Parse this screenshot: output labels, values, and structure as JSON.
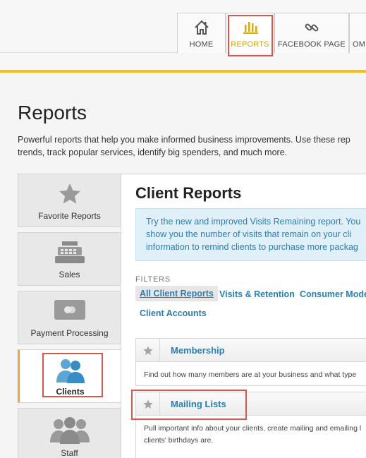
{
  "nav": {
    "tabs": [
      {
        "label": "HOME",
        "icon": "home-icon"
      },
      {
        "label": "REPORTS",
        "icon": "bar-chart-icon",
        "active": true
      },
      {
        "label": "FACEBOOK PAGE",
        "icon": "link-icon"
      },
      {
        "label": "OM",
        "icon": ""
      }
    ]
  },
  "page": {
    "title": "Reports",
    "description_line1": "Powerful reports that help you make informed business improvements. Use these rep",
    "description_line2": "trends, track popular services, identify big spenders, and much more."
  },
  "sidebar": {
    "items": [
      {
        "label": "Favorite Reports",
        "icon": "star-icon"
      },
      {
        "label": "Sales",
        "icon": "cash-register-icon"
      },
      {
        "label": "Payment Processing",
        "icon": "credit-card-icon"
      },
      {
        "label": "Clients",
        "icon": "clients-icon",
        "active": true
      },
      {
        "label": "Staff",
        "icon": "staff-icon"
      }
    ]
  },
  "main": {
    "title": "Client Reports",
    "notice_line1": "Try the new and improved Visits Remaining report. You",
    "notice_line2": "show you the number of visits that remain on your cli",
    "notice_line3": "information to remind clients to purchase more packag",
    "filters_label": "FILTERS",
    "filters": [
      "All Client Reports",
      "Visits & Retention",
      "Consumer Mode",
      "Client Accounts"
    ],
    "reports": [
      {
        "name": "Membership",
        "desc_line1": "Find out how many members are at your business and what type",
        "desc_line2": ""
      },
      {
        "name": "Mailing Lists",
        "desc_line1": "Pull important info about your clients, create mailing and emailing l",
        "desc_line2": "clients' birthdays are."
      }
    ]
  },
  "colors": {
    "accent_yellow": "#f2c113",
    "link_blue": "#2a7fb0",
    "highlight_red": "#d9534f",
    "active_orange": "#f2a43a"
  }
}
